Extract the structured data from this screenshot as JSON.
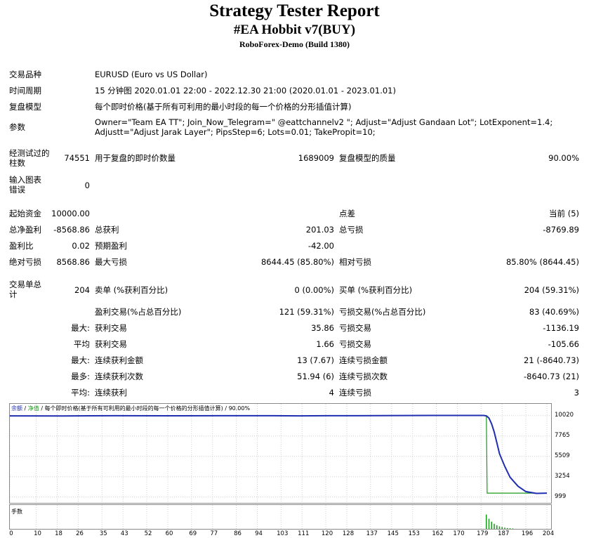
{
  "header": {
    "title": "Strategy Tester Report",
    "expert": "#EA Hobbit v7(BUY)",
    "server": "RoboForex-Demo (Build 1380)"
  },
  "info": {
    "symbol_label": "交易品种",
    "symbol_value": "EURUSD (Euro vs US Dollar)",
    "period_label": "时间周期",
    "period_value": "15 分钟图 2020.01.01 22:00 - 2022.12.30 21:00 (2020.01.01 - 2023.01.01)",
    "model_label": "复盘模型",
    "model_value": "每个即时价格(基于所有可利用的最小时段的每一个价格的分形插值计算)",
    "params_label": "参数",
    "params_line1": "Owner=\"Team EA TT\"; Join_Now_Telegram=\" @eattchannelv2 \"; Adjust=\"Adjust Gandaan Lot\"; LotExponent=1.4;",
    "params_line2": "Adjustt=\"Adjust Jarak Layer\"; PipsStep=6; Lots=0.01; TakePropit=10;"
  },
  "stats": {
    "bars_label": "经测试过的柱数",
    "bars_value": "74551",
    "ticks_label": "用于复盘的即时价数量",
    "ticks_value": "1689009",
    "quality_label": "复盘模型的质量",
    "quality_value": "90.00%",
    "errors_label": "输入图表错误",
    "errors_value": "0",
    "deposit_label": "起始资金",
    "deposit_value": "10000.00",
    "spread_label": "点差",
    "spread_value": "当前 (5)",
    "net_label": "总净盈利",
    "net_value": "-8568.86",
    "gross_profit_label": "总获利",
    "gross_profit_value": "201.03",
    "gross_loss_label": "总亏损",
    "gross_loss_value": "-8769.89",
    "pf_label": "盈利比",
    "pf_value": "0.02",
    "payoff_label": "预期盈利",
    "payoff_value": "-42.00",
    "abs_dd_label": "绝对亏损",
    "abs_dd_value": "8568.86",
    "max_dd_label": "最大亏损",
    "max_dd_value": "8644.45 (85.80%)",
    "rel_dd_label": "相对亏损",
    "rel_dd_value": "85.80% (8644.45)",
    "total_trades_label": "交易单总计",
    "total_trades_value": "204",
    "short_label": "卖单 (%获利百分比)",
    "short_value": "0 (0.00%)",
    "long_label": "买单 (%获利百分比)",
    "long_value": "204 (59.31%)",
    "profit_trades_label": "盈利交易(%占总百分比)",
    "profit_trades_value": "121 (59.31%)",
    "loss_trades_label": "亏损交易(%占总百分比)",
    "loss_trades_value": "83 (40.69%)",
    "largest_prefix": "最大:",
    "largest_profit_label": "获利交易",
    "largest_profit_value": "35.86",
    "largest_loss_label": "亏损交易",
    "largest_loss_value": "-1136.19",
    "average_prefix": "平均",
    "average_profit_label": "获利交易",
    "average_profit_value": "1.66",
    "average_loss_label": "亏损交易",
    "average_loss_value": "-105.66",
    "max_prefix": "最大:",
    "max_consec_wins_label": "连续获利金额",
    "max_consec_wins_value": "13 (7.67)",
    "max_consec_losses_label": "连续亏损金额",
    "max_consec_losses_value": "21 (-8640.73)",
    "maximal_prefix": "最多:",
    "maximal_consec_profit_label": "连续获利次数",
    "maximal_consec_profit_value": "51.94 (6)",
    "maximal_consec_loss_label": "连续亏损次数",
    "maximal_consec_loss_value": "-8640.73 (21)",
    "avg_prefix": "平均:",
    "avg_consec_wins_label": "连续获利",
    "avg_consec_wins_value": "4",
    "avg_consec_losses_label": "连续亏损",
    "avg_consec_losses_value": "3"
  },
  "chart_data": {
    "type": "line",
    "legend": {
      "balance": "余额",
      "sep1": " / ",
      "equity": "净值",
      "sep2": " / ",
      "model": "每个即时价格(基于所有可利用的最小时段的每一个价格的分形插值计算) / 90.00%"
    },
    "colors": {
      "balance": "#1f2fb0",
      "equity": "#1a9a1a",
      "lots": "#1a9a1a"
    },
    "y_ticks": [
      "10020",
      "7765",
      "5509",
      "3254",
      "999"
    ],
    "ylim": [
      660,
      10550
    ],
    "x_ticks": [
      "0",
      "10",
      "18",
      "26",
      "35",
      "43",
      "52",
      "60",
      "69",
      "77",
      "86",
      "94",
      "103",
      "111",
      "120",
      "128",
      "137",
      "145",
      "153",
      "162",
      "170",
      "179",
      "187",
      "196",
      "204"
    ],
    "xlim": [
      0,
      204
    ],
    "series": [
      {
        "name": "余额",
        "x": [
          0,
          20,
          40,
          60,
          80,
          100,
          110,
          120,
          140,
          160,
          170,
          178,
          180,
          181,
          182,
          183,
          184,
          185,
          186,
          188,
          190,
          193,
          196,
          200,
          204
        ],
        "y": [
          10000,
          9990,
          10010,
          10005,
          10010,
          10010,
          10000,
          10015,
          10020,
          10040,
          10040,
          10040,
          10040,
          10000,
          9750,
          9100,
          8200,
          7000,
          5800,
          4400,
          3200,
          2200,
          1600,
          1400,
          1431
        ]
      },
      {
        "name": "净值",
        "x": [
          0,
          20,
          40,
          60,
          80,
          100,
          110,
          120,
          140,
          160,
          170,
          178,
          180,
          181,
          181.3,
          182,
          184,
          190,
          204
        ],
        "y": [
          10000,
          9990,
          10010,
          10005,
          10010,
          10010,
          10000,
          10015,
          10020,
          10040,
          10040,
          10040,
          10040,
          10000,
          1431,
          1431,
          1431,
          1431,
          1431
        ]
      }
    ],
    "lots_label": "手数",
    "lots": {
      "x": [
        181,
        182,
        183,
        184,
        185,
        186,
        187,
        188,
        189,
        190,
        191
      ],
      "y": [
        0.68,
        0.48,
        0.34,
        0.24,
        0.17,
        0.12,
        0.09,
        0.06,
        0.04,
        0.03,
        0.02
      ]
    }
  }
}
